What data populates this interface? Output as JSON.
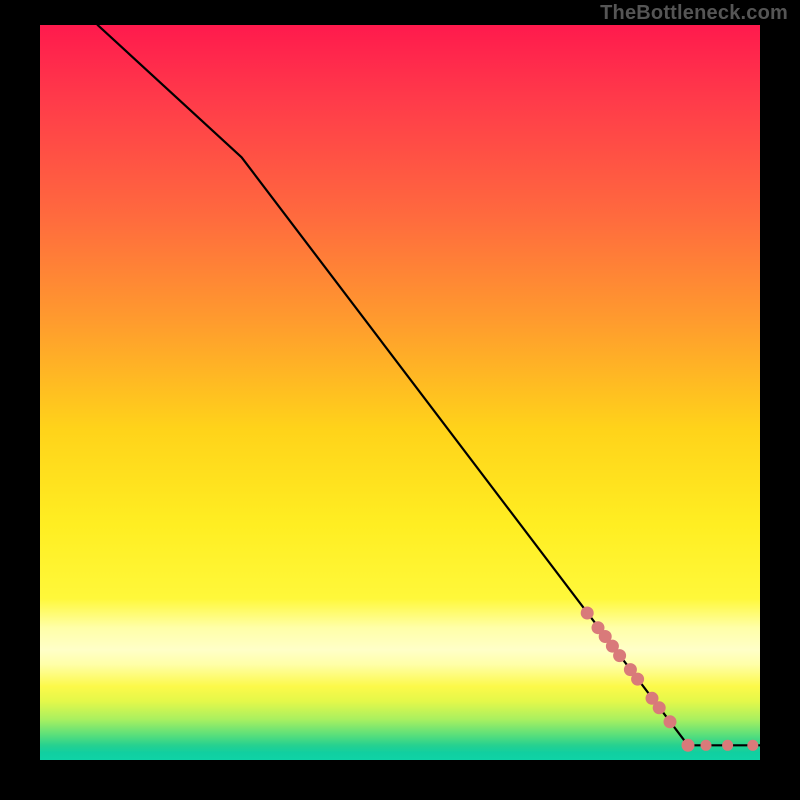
{
  "watermark": "TheBottleneck.com",
  "chart_data": {
    "type": "line",
    "title": "",
    "xlabel": "",
    "ylabel": "",
    "xlim": [
      0,
      100
    ],
    "ylim": [
      0,
      100
    ],
    "grid": false,
    "legend": false,
    "colors": {
      "line": "#000000",
      "markers": "#d97a7a",
      "gradient_stops": [
        {
          "pos": 0,
          "color": "#ff1a4d"
        },
        {
          "pos": 0.4,
          "color": "#ff9a2e"
        },
        {
          "pos": 0.68,
          "color": "#ffee22"
        },
        {
          "pos": 0.85,
          "color": "#ffffc8"
        },
        {
          "pos": 0.95,
          "color": "#5de07a"
        },
        {
          "pos": 1.0,
          "color": "#0fd3a6"
        }
      ]
    },
    "line_points": [
      {
        "x": 8,
        "y": 100
      },
      {
        "x": 28,
        "y": 82
      },
      {
        "x": 90,
        "y": 2
      },
      {
        "x": 100,
        "y": 2
      }
    ],
    "marker_points": [
      {
        "x": 76.0,
        "y": 20.0,
        "r": 6
      },
      {
        "x": 77.5,
        "y": 18.0,
        "r": 6
      },
      {
        "x": 78.5,
        "y": 16.8,
        "r": 6
      },
      {
        "x": 79.5,
        "y": 15.5,
        "r": 6
      },
      {
        "x": 80.5,
        "y": 14.2,
        "r": 6
      },
      {
        "x": 82.0,
        "y": 12.3,
        "r": 6
      },
      {
        "x": 83.0,
        "y": 11.0,
        "r": 6
      },
      {
        "x": 85.0,
        "y": 8.4,
        "r": 6
      },
      {
        "x": 86.0,
        "y": 7.1,
        "r": 6
      },
      {
        "x": 87.5,
        "y": 5.2,
        "r": 6
      },
      {
        "x": 90.0,
        "y": 2.0,
        "r": 6
      },
      {
        "x": 92.5,
        "y": 2.0,
        "r": 5
      },
      {
        "x": 95.5,
        "y": 2.0,
        "r": 5
      },
      {
        "x": 99.0,
        "y": 2.0,
        "r": 5
      }
    ]
  }
}
